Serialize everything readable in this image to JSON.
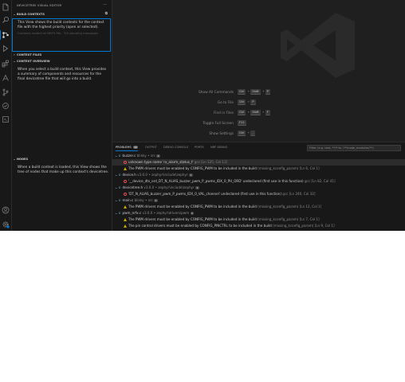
{
  "sidebar": {
    "title": "DEVICETREE VISUAL EDITOR",
    "more": "···",
    "build_contexts": {
      "header": "BUILD CONTEXTS",
      "text": "This View shows the build contexts for the context file with the highest priority (open or selected).",
      "faded": "Contexts loaded at NRF5 fifo · 3/4 pending messages"
    },
    "context_files": {
      "header": "CONTEXT FILES"
    },
    "context_overview": {
      "header": "CONTEXT OVERVIEW",
      "text": "When you select a build context, this View provides a summary of components and resources for the final devicetree file that will go into a build."
    },
    "nodes": {
      "header": "NODES",
      "text": "When a build context is loaded, this View shows the tree of nodes that make up this context's devicetree."
    }
  },
  "shortcuts": [
    {
      "label": "Show All Commands",
      "keys": [
        "Ctrl",
        "Shift",
        "P"
      ]
    },
    {
      "label": "Go to File",
      "keys": [
        "Ctrl",
        "P"
      ]
    },
    {
      "label": "Find in Files",
      "keys": [
        "Ctrl",
        "Shift",
        "F"
      ]
    },
    {
      "label": "Toggle Full Screen",
      "keys": [
        "F11"
      ]
    },
    {
      "label": "Show Settings",
      "keys": [
        "Ctrl",
        ","
      ]
    }
  ],
  "panel": {
    "tabs": [
      {
        "label": "PROBLEMS",
        "count": "12"
      },
      {
        "label": "OUTPUT"
      },
      {
        "label": "DEBUG CONSOLE"
      },
      {
        "label": "PORTS"
      },
      {
        "label": "NRF DEBUG"
      }
    ],
    "filter_placeholder": "Filter (e.g. text, **/*.ts, !**/node_modules/**)",
    "rows": [
      {
        "kind": "file",
        "name": "buzzer.c",
        "path": "blinky • src",
        "count": "2"
      },
      {
        "kind": "error",
        "selected": true,
        "msg": "unknown type name 'rx_alarm_status_t'",
        "src": "gcc [Ln 125, Col 11]"
      },
      {
        "kind": "warning",
        "msg": "The PWM drivers must be enabled by CONFIG_PWM to be included in the build",
        "src": "(missing_kconfig_param) [Ln 6, Col 1]"
      },
      {
        "kind": "file",
        "name": "device.h",
        "path": "v3.6.0 • zephyr\\include\\zephyr",
        "count": "1"
      },
      {
        "kind": "error",
        "msg": "'__device_dts_ord_DT_N_ALIAS_buzzer_pwm_P_pwms_IDX_0_PH_ORD' undeclared (first use in this function)",
        "src": "gcc [Ln 82, Col 41]"
      },
      {
        "kind": "file",
        "name": "devicetree.h",
        "path": "v3.6.0 • zephyr\\include\\zephyr",
        "count": "1"
      },
      {
        "kind": "error",
        "msg": "'DT_N_ALIAS_buzzer_pwm_P_pwms_IDX_0_VAL_channel' undeclared (first use in this function)",
        "src": "gcc [Ln 240, Col 32]"
      },
      {
        "kind": "file",
        "name": "main.c",
        "path": "blinky • src",
        "count": "1"
      },
      {
        "kind": "warning",
        "msg": "The PWM drivers must be enabled by CONFIG_PWM to be included in the build",
        "src": "(missing_kconfig_param) [Ln 12, Col 1]"
      },
      {
        "kind": "file",
        "name": "pwm_nrfx.c",
        "path": "v3.6.0 • zephyr\\drivers\\pwm",
        "count": "2"
      },
      {
        "kind": "warning",
        "msg": "The PWM drivers must be enabled by CONFIG_PWM to be included in the build",
        "src": "(missing_kconfig_param) [Ln 7, Col 1]"
      },
      {
        "kind": "warning",
        "msg": "The pin control drivers must be enabled by CONFIG_PINCTRL to be included in the build",
        "src": "(missing_kconfig_param) [Ln 9, Col 1]"
      }
    ]
  },
  "icons": [
    "explorer-icon",
    "search-icon",
    "devicetree-icon",
    "run-debug-icon",
    "extensions-icon",
    "nrf-connect-icon",
    "source-control-icon",
    "testing-icon",
    "remote-icon",
    "account-icon",
    "settings-icon"
  ],
  "colors": {
    "accent": "#0078d4",
    "error": "#f14c4c",
    "warning": "#cca700",
    "c_file": "#519aba"
  }
}
